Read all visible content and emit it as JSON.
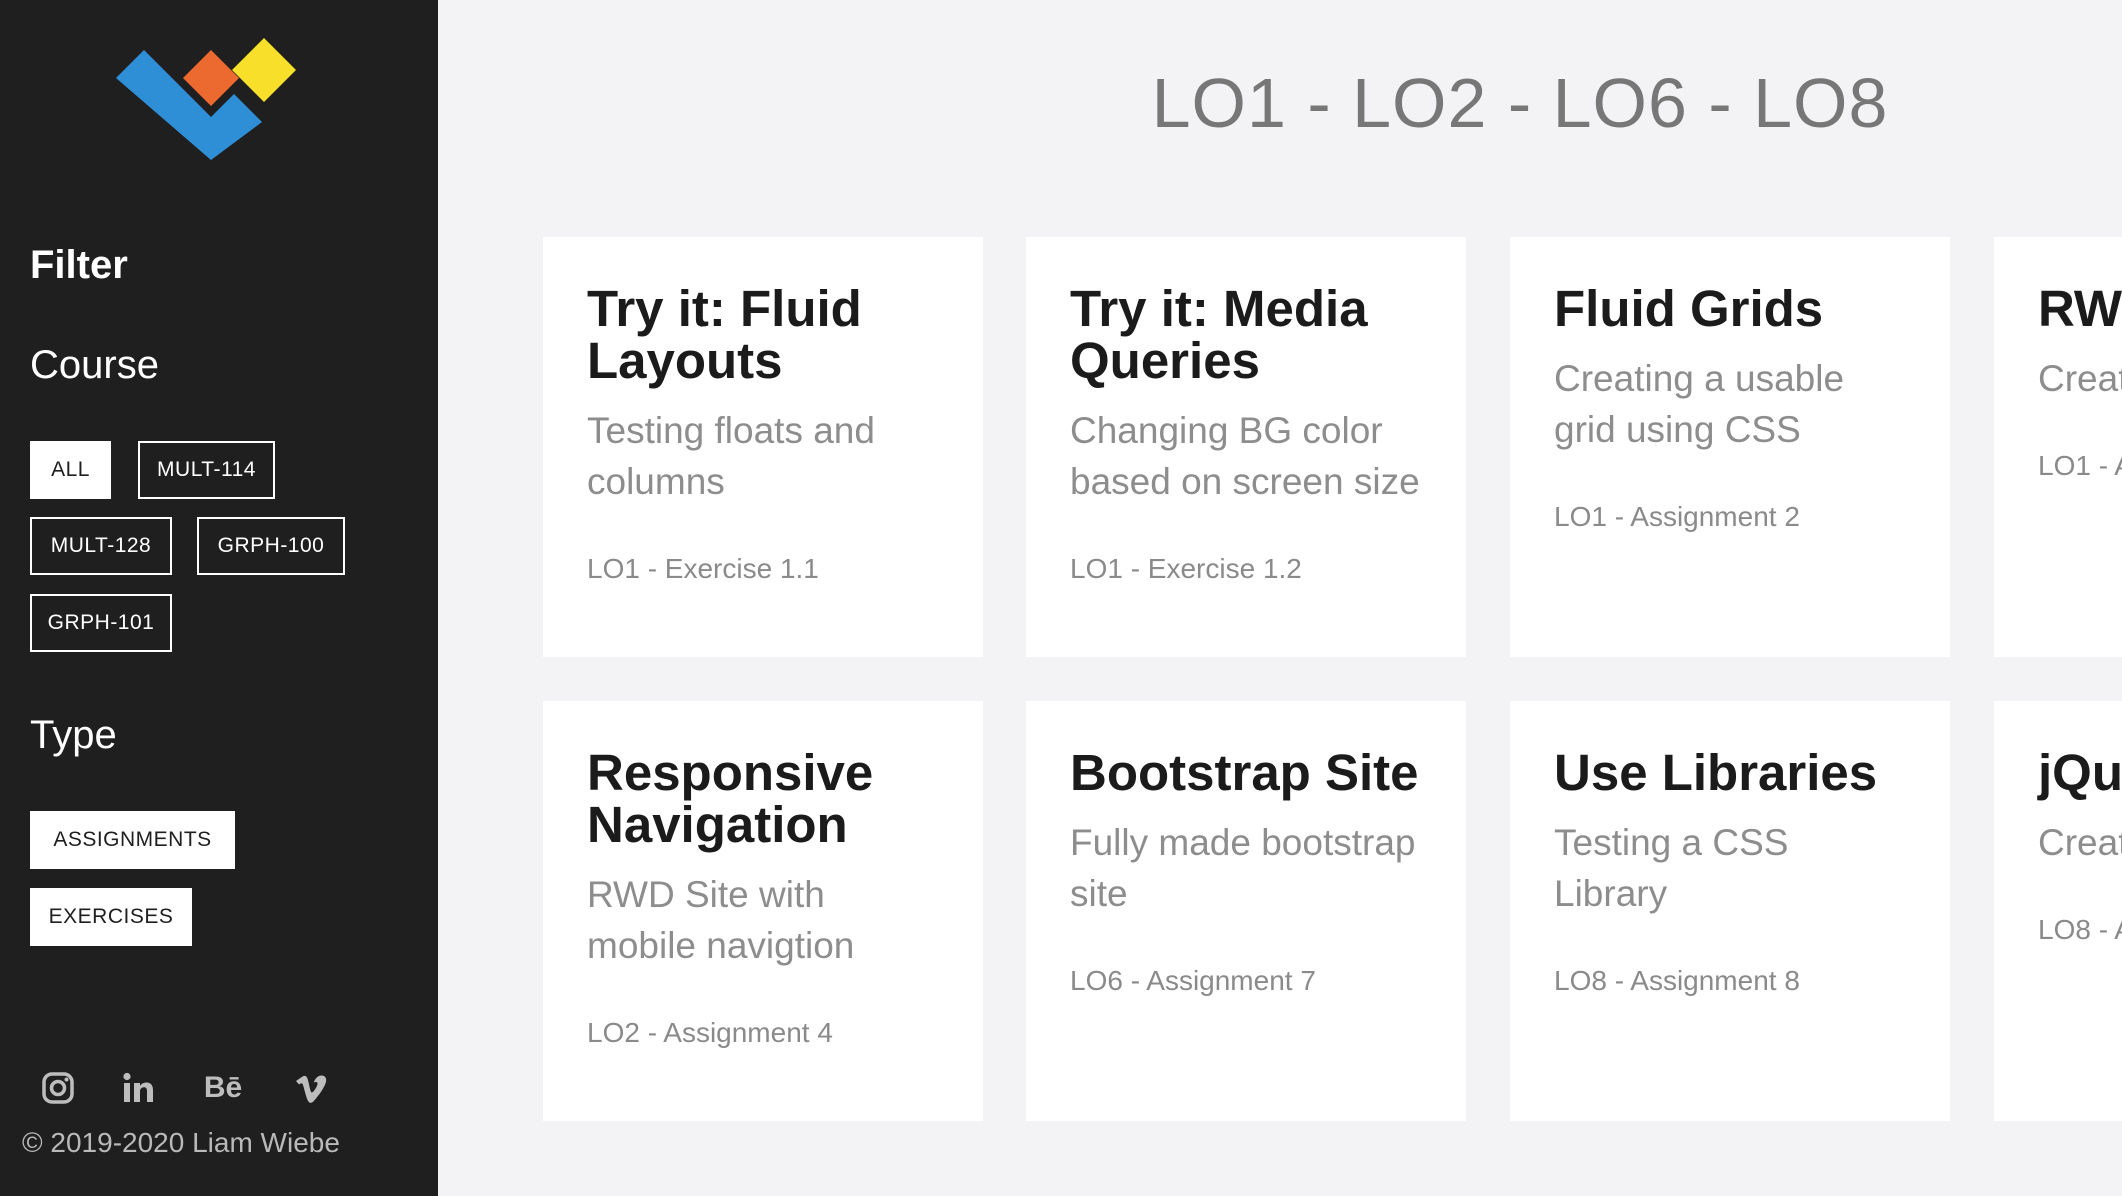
{
  "sidebar": {
    "logo": "logo-icon",
    "filter_title": "Filter",
    "course_title": "Course",
    "course_filters": [
      "ALL",
      "MULT-114",
      "MULT-128",
      "GRPH-100",
      "GRPH-101"
    ],
    "type_title": "Type",
    "type_filters": [
      "ASSIGNMENTS",
      "EXERCISES"
    ],
    "social": [
      "instagram-icon",
      "linkedin-icon",
      "behance-icon",
      "vimeo-icon"
    ],
    "behance_text": "Bē",
    "copyright": "© 2019-2020 Liam Wiebe"
  },
  "main": {
    "title": "LO1 - LO2 - LO6 - LO8",
    "cards": [
      {
        "title": "Try it: Fluid Layouts",
        "desc": "Testing floats and columns",
        "meta": "LO1 - Exercise 1.1"
      },
      {
        "title": "Try it: Media Queries",
        "desc": "Changing BG color based on screen size",
        "meta": "LO1 - Exercise 1.2"
      },
      {
        "title": "Fluid Grids",
        "desc": "Creating a usable grid using CSS",
        "meta": "LO1 - Assignment 2"
      },
      {
        "title": "RW Hor",
        "desc": "Creat home",
        "meta": "LO1 - A"
      },
      {
        "title": "Responsive Navigation",
        "desc": "RWD Site with mobile navigtion",
        "meta": "LO2 - Assignment 4"
      },
      {
        "title": "Bootstrap Site",
        "desc": "Fully made bootstrap site",
        "meta": "LO6 - Assignment 7"
      },
      {
        "title": "Use Libraries",
        "desc": "Testing a CSS Library",
        "meta": "LO8 - Assignment 8"
      },
      {
        "title": "jQu",
        "desc": "Creat site w",
        "meta": "LO8 - A"
      }
    ]
  },
  "colors": {
    "sidebar_bg": "#1f1f1f",
    "page_bg": "#f3f3f6",
    "logo_blue": "#2f8fd6",
    "logo_orange": "#ec6a2f",
    "logo_yellow": "#f7df2a"
  }
}
